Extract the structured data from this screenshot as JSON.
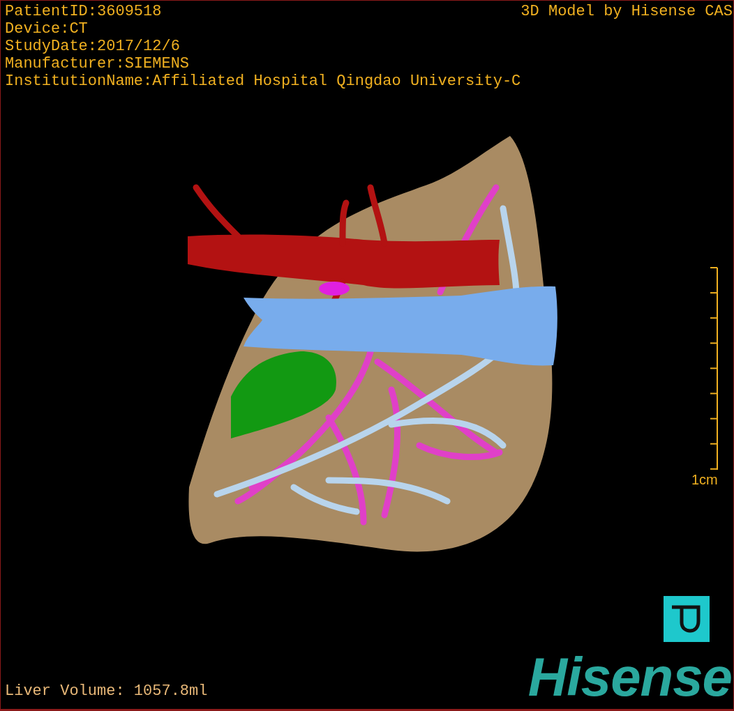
{
  "patient_info": [
    "PatientID:3609518",
    "Device:CT",
    "StudyDate:2017/12/6",
    "Manufacturer:SIEMENS",
    "InstitutionName:Affiliated Hospital Qingdao University-C"
  ],
  "title": "3D Model by Hisense CAS",
  "scale_bar": {
    "label": "1cm"
  },
  "liver_volume": "Liver Volume: 1057.8ml",
  "logo": {
    "text": "Hisense"
  }
}
